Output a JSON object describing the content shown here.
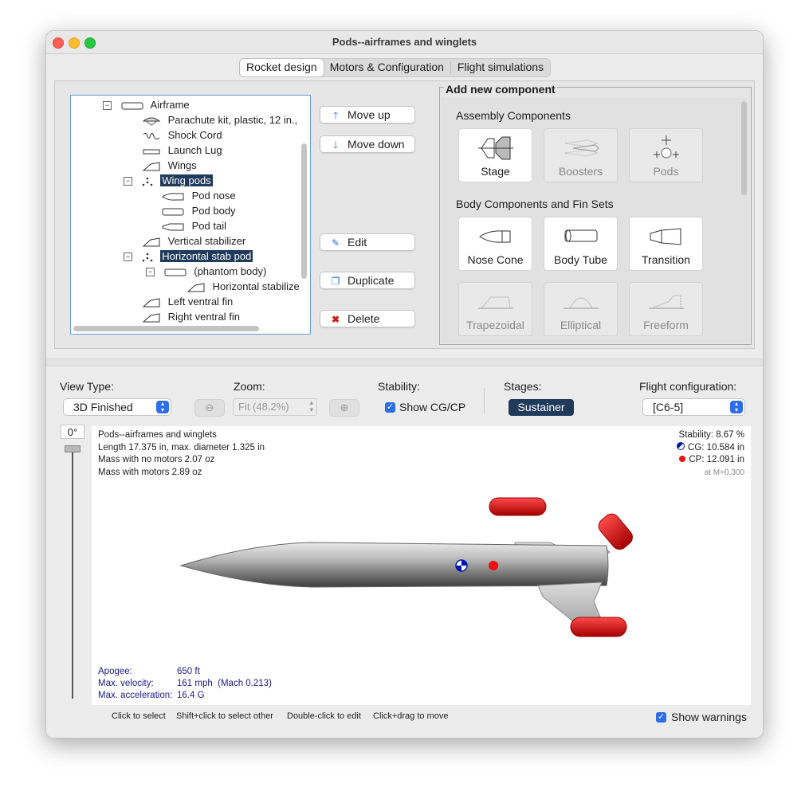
{
  "window": {
    "title": "Pods--airframes and winglets"
  },
  "tabs": [
    "Rocket design",
    "Motors & Configuration",
    "Flight simulations"
  ],
  "tree": {
    "items": [
      {
        "label": "Airframe",
        "icon": "body-tube-icon"
      },
      {
        "label": "Parachute kit, plastic, 12 in.,",
        "icon": "parachute-icon"
      },
      {
        "label": "Shock Cord",
        "icon": "shock-cord-icon"
      },
      {
        "label": "Launch Lug",
        "icon": "launch-lug-icon"
      },
      {
        "label": "Wings",
        "icon": "fin-icon"
      },
      {
        "label": "Wing pods",
        "icon": "pods-icon"
      },
      {
        "label": "Pod nose",
        "icon": "nose-cone-icon"
      },
      {
        "label": "Pod body",
        "icon": "body-tube-icon"
      },
      {
        "label": "Pod tail",
        "icon": "transition-icon"
      },
      {
        "label": "Vertical stabilizer",
        "icon": "fin-icon"
      },
      {
        "label": "Horizontal stab pod",
        "icon": "pods-icon"
      },
      {
        "label": "(phantom body)",
        "icon": "body-tube-icon"
      },
      {
        "label": "Horizontal stabilize",
        "icon": "fin-icon"
      },
      {
        "label": "Left ventral fin",
        "icon": "fin-icon"
      },
      {
        "label": "Right ventral fin",
        "icon": "fin-icon"
      }
    ]
  },
  "actions": {
    "move_up": "Move up",
    "move_down": "Move down",
    "edit": "Edit",
    "duplicate": "Duplicate",
    "delete": "Delete"
  },
  "add_panel": {
    "title": "Add new component",
    "assembly_heading": "Assembly Components",
    "body_heading": "Body Components and Fin Sets",
    "assembly": [
      "Stage",
      "Boosters",
      "Pods"
    ],
    "body": [
      "Nose Cone",
      "Body Tube",
      "Transition"
    ],
    "fins": [
      "Trapezoidal",
      "Elliptical",
      "Freeform"
    ]
  },
  "controls": {
    "view_type_label": "View Type:",
    "view_type_value": "3D Finished",
    "zoom_label": "Zoom:",
    "zoom_value": "Fit (48.2%)",
    "stability_label": "Stability:",
    "show_cgcp": "Show CG/CP",
    "stages_label": "Stages:",
    "stage_button": "Sustainer",
    "flight_config_label": "Flight configuration:",
    "flight_config_value": "[C6-5]"
  },
  "view": {
    "rotation": "0°",
    "name": "Pods--airframes and winglets",
    "length_line": "Length 17.375 in, max. diameter 1.325 in",
    "mass_no_motors": "Mass with no motors 2.07 oz",
    "mass_with_motors": "Mass with motors 2.89 oz",
    "stability": "Stability: 8.67 %",
    "cg": "CG: 10.584 in",
    "cp": "CP: 12.091 in",
    "mach": "at M=0.300",
    "apogee_label": "Apogee:",
    "apogee_value": "650 ft",
    "velocity_label": "Max. velocity:",
    "velocity_value": "161 mph  (Mach 0.213)",
    "accel_label": "Max. acceleration:",
    "accel_value": "16.4 G"
  },
  "status": {
    "hint1": "Click to select",
    "hint2": "Shift+click to select other",
    "hint3": "Double-click to edit",
    "hint4": "Click+drag to move",
    "show_warnings": "Show warnings"
  },
  "colors": {
    "selection": "#1f3a5a",
    "accent": "#2b6ee8",
    "fin_red": "#e01010",
    "flight_text": "#1a1a8c"
  }
}
